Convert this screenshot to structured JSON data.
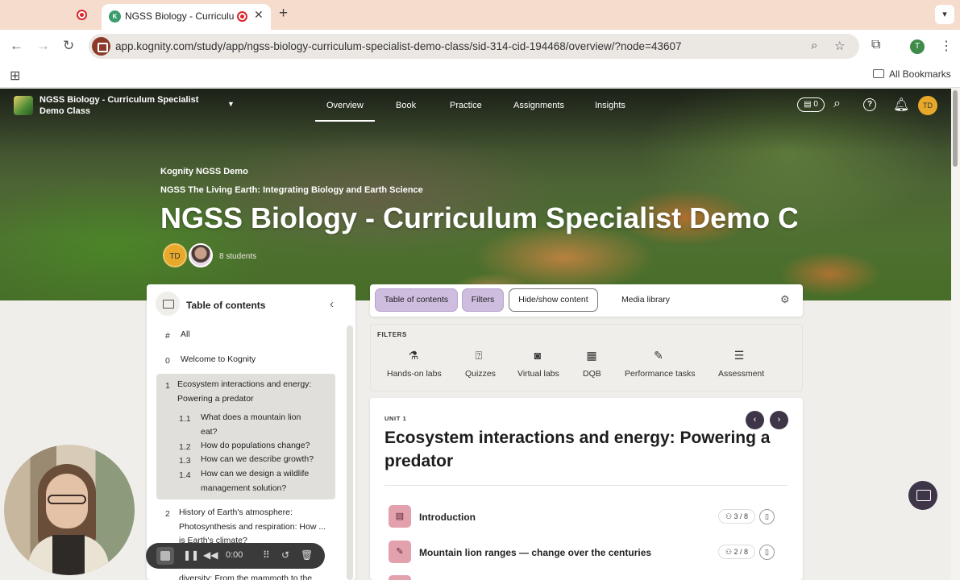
{
  "browser": {
    "active_tab_title": "NGSS Biology - Curriculum Specialist Demo Class",
    "url": "app.kognity.com/study/app/ngss-biology-curriculum-specialist-demo-class/sid-314-cid-194468/overview/?node=43607",
    "bookmarks_label": "All Bookmarks",
    "profile_initial": "T",
    "favicon_text": "K"
  },
  "header": {
    "class_name": "NGSS Biology - Curriculum Specialist Demo Class",
    "nav": [
      "Overview",
      "Book",
      "Practice",
      "Assignments",
      "Insights"
    ],
    "active_nav": "Overview",
    "notes_count": "0",
    "user_initials": "TD"
  },
  "hero": {
    "school": "Kognity NGSS Demo",
    "subject": "NGSS The Living Earth: Integrating Biology and Earth Science",
    "title": "NGSS Biology - Curriculum Specialist Demo C...",
    "teacher_initials": "TD",
    "students": "8 students"
  },
  "toc": {
    "title": "Table of contents",
    "items": [
      {
        "num": "#",
        "text": "All"
      },
      {
        "num": "0",
        "text": "Welcome to Kognity"
      },
      {
        "num": "1",
        "text": "Ecosystem interactions and energy: Powering a predator"
      },
      {
        "num": "1.1",
        "text": "What does a mountain lion eat?"
      },
      {
        "num": "1.2",
        "text": "How do populations change?"
      },
      {
        "num": "1.3",
        "text": "How can we describe growth?"
      },
      {
        "num": "1.4",
        "text": "How can we design a wildlife management solution?"
      },
      {
        "num": "2",
        "text": "History of Earth's atmosphere: Photosynthesis and respiration: How ... is Earth's climate?"
      },
      {
        "num": "",
        "text": "diversity: From the mammoth to the"
      }
    ]
  },
  "toolbar": {
    "table_of_contents": "Table of contents",
    "filters": "Filters",
    "hide_show": "Hide/show content",
    "media_library": "Media library"
  },
  "filters": {
    "label": "FILTERS",
    "items": [
      "Hands-on labs",
      "Quizzes",
      "Virtual labs",
      "DQB",
      "Performance tasks",
      "Assessment"
    ]
  },
  "unit": {
    "label": "UNIT 1",
    "title": "Ecosystem interactions and energy: Powering a predator",
    "rows": [
      {
        "title": "Introduction",
        "progress": "3 / 8"
      },
      {
        "title": "Mountain lion ranges — change over the centuries",
        "progress": "2 / 8"
      }
    ]
  },
  "recorder": {
    "time": "0:00"
  },
  "colors": {
    "accent_purple": "#3f3548",
    "pill_active": "#cfbde0",
    "row_icon": "#e3a0ad",
    "avatar": "#e8a92a"
  }
}
